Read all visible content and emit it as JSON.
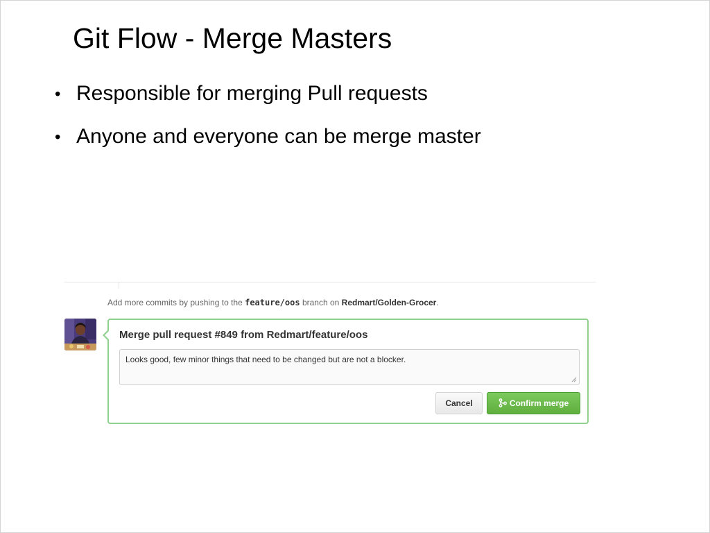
{
  "slide": {
    "title": "Git Flow - Merge Masters",
    "bullets": [
      "Responsible for merging Pull requests",
      "Anyone and everyone can be merge master"
    ],
    "bullet_glyph": "•"
  },
  "screenshot": {
    "hint": {
      "prefix": "Add more commits by pushing to the",
      "branch": "feature/oos",
      "middle": "branch on",
      "repo": "Redmart/Golden-Grocer",
      "suffix": "."
    },
    "merge": {
      "title": "Merge pull request #849 from Redmart/feature/oos",
      "message": "Looks good, few minor things that need to be changed but are not a blocker.",
      "cancel_label": "Cancel",
      "confirm_label": "Confirm merge"
    },
    "colors": {
      "confirm_green": "#6cbb4a",
      "box_border": "#8fd18c"
    },
    "icons": [
      "avatar",
      "git-merge-icon",
      "resize-grip-icon"
    ]
  }
}
